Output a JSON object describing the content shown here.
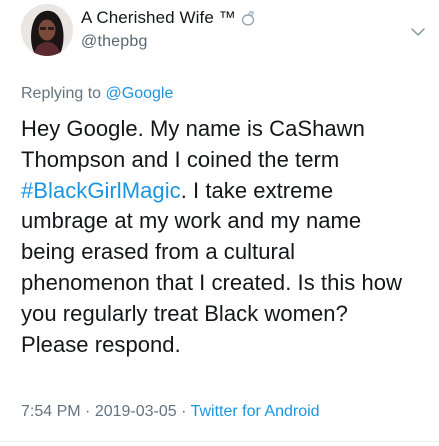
{
  "author": {
    "display_name": "A Cherished Wife ™",
    "handle": "@thepbg"
  },
  "reply": {
    "prefix": "Replying to ",
    "mention": "@Google"
  },
  "tweet": {
    "line1": "Hey Google. My name is CaShawn",
    "line2": "Thompson and I  coined the term",
    "hashtag": "#BlackGirlMagic",
    "line3_rest": ". I take extreme",
    "line4": "umbrage at my work and my name",
    "line5": "being erased from a cultural",
    "line6": "phenomenon that I created. Is this how",
    "line7": "you regularly treat Black women?",
    "line8": "Please respond."
  },
  "meta": {
    "time": "7:54 PM",
    "sep1": " · ",
    "date": "2019-03-05",
    "sep2": " · ",
    "source": "Twitter for Android"
  },
  "icons": {
    "ring": "ring-icon",
    "caret": "chevron-down-icon"
  },
  "colors": {
    "link": "#1b95e0",
    "secondary_text": "#65737e",
    "primary_text": "#14171a"
  }
}
